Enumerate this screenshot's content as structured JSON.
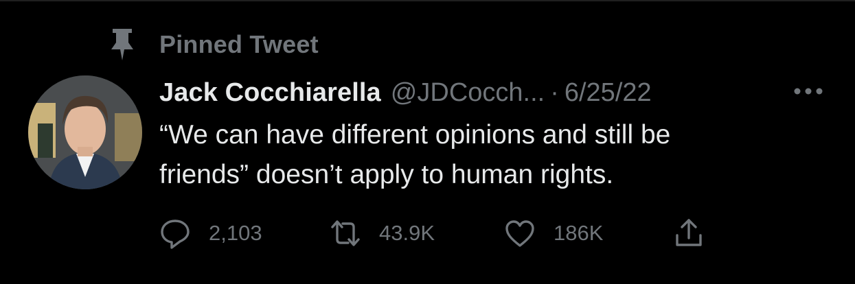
{
  "pinned": {
    "label": "Pinned Tweet",
    "icon": "pin-icon"
  },
  "author": {
    "name": "Jack Cocchiarella",
    "handle": "@JDCocch...",
    "avatar_icon": "avatar-photo"
  },
  "meta": {
    "separator": "·",
    "date": "6/25/22"
  },
  "more": {
    "icon": "more-horizontal-icon"
  },
  "tweet": {
    "lines": [
      "“We can have different opinions and still be",
      "friends” doesn’t apply to human rights."
    ]
  },
  "actions": {
    "reply": {
      "icon": "reply-icon",
      "count": "2,103"
    },
    "retweet": {
      "icon": "retweet-icon",
      "count": "43.9K"
    },
    "like": {
      "icon": "heart-icon",
      "count": "186K"
    },
    "share": {
      "icon": "share-icon"
    }
  },
  "colors": {
    "background": "#000000",
    "primary_text": "#e7e9ea",
    "secondary_text": "#71767b"
  }
}
